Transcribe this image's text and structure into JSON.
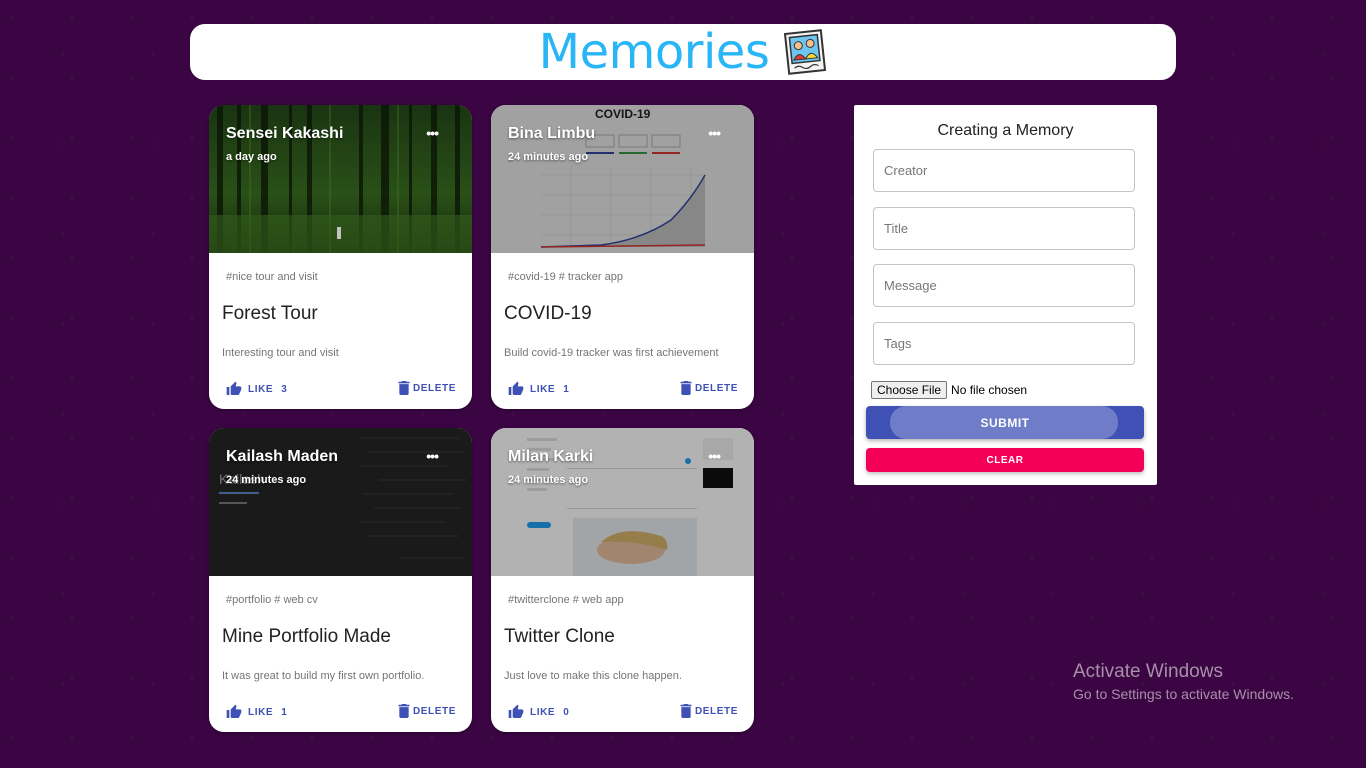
{
  "app": {
    "title": "Memories",
    "logo_icon": "memories-photo-icon"
  },
  "posts": [
    {
      "creator": "Sensei Kakashi",
      "time": "a day ago",
      "tags": "#nice tour and visit",
      "title": "Forest Tour",
      "message": "Interesting tour and visit",
      "like_label": "LIKE",
      "likes": "3",
      "delete_label": "DELETE",
      "more_label": "•••"
    },
    {
      "creator": "Bina Limbu",
      "time": "24 minutes ago",
      "tags": "#covid-19 # tracker app",
      "title": "COVID-19",
      "message": "Build covid-19 tracker was first achievement",
      "like_label": "LIKE",
      "likes": "1",
      "delete_label": "DELETE",
      "more_label": "•••",
      "image_text": "COVID-19"
    },
    {
      "creator": "Kailash Maden",
      "time": "24 minutes ago",
      "tags": "#portfolio # web cv",
      "title": "Mine Portfolio Made",
      "message": "It was great to build my first own portfolio.",
      "like_label": "LIKE",
      "likes": "1",
      "delete_label": "DELETE",
      "more_label": "•••",
      "image_text": "Kailash"
    },
    {
      "creator": "Milan Karki",
      "time": "24 minutes ago",
      "tags": "#twitterclone # web app",
      "title": "Twitter Clone",
      "message": "Just love to make this clone happen.",
      "like_label": "LIKE",
      "likes": "0",
      "delete_label": "DELETE",
      "more_label": "•••"
    }
  ],
  "form": {
    "heading": "Creating a Memory",
    "creator_placeholder": "Creator",
    "title_placeholder": "Title",
    "message_placeholder": "Message",
    "tags_placeholder": "Tags",
    "file_button": "Choose File",
    "file_status": "No file chosen",
    "submit_label": "SUBMIT",
    "clear_label": "CLEAR"
  },
  "watermark": {
    "line1": "Activate Windows",
    "line2": "Go to Settings to activate Windows."
  },
  "colors": {
    "background": "#3a0542",
    "title": "#29b6f6",
    "primary": "#3f51b5",
    "secondary": "#f50057"
  }
}
